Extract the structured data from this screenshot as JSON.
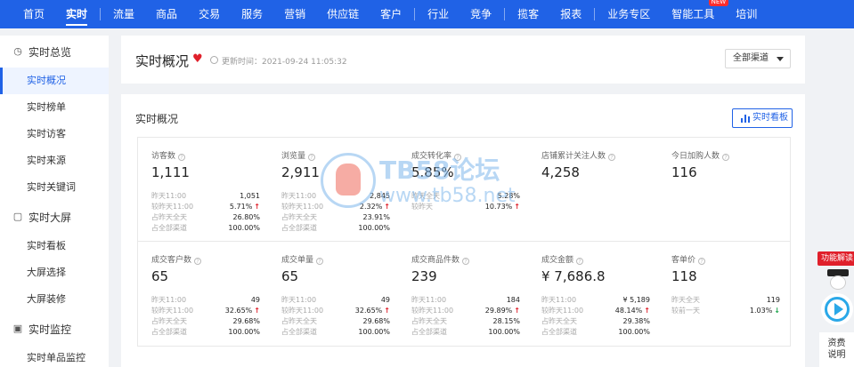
{
  "topnav": {
    "items": [
      {
        "label": "首页",
        "active": false
      },
      {
        "label": "实时",
        "active": true
      },
      {
        "label": "流量",
        "active": false
      },
      {
        "label": "商品",
        "active": false
      },
      {
        "label": "交易",
        "active": false
      },
      {
        "label": "服务",
        "active": false
      },
      {
        "label": "营销",
        "active": false
      },
      {
        "label": "供应链",
        "active": false
      },
      {
        "label": "客户",
        "active": false
      },
      {
        "label": "行业",
        "active": false
      },
      {
        "label": "竞争",
        "active": false
      },
      {
        "label": "揽客",
        "active": false
      },
      {
        "label": "报表",
        "active": false
      },
      {
        "label": "业务专区",
        "active": false
      },
      {
        "label": "智能工具",
        "active": false,
        "badge": "NEW"
      },
      {
        "label": "培训",
        "active": false
      }
    ]
  },
  "sidebar": {
    "groups": [
      {
        "title": "实时总览",
        "icon": "clock-icon",
        "items": [
          {
            "label": "实时概况",
            "active": true
          },
          {
            "label": "实时榜单",
            "active": false
          },
          {
            "label": "实时访客",
            "active": false
          },
          {
            "label": "实时来源",
            "active": false
          },
          {
            "label": "实时关键词",
            "active": false
          }
        ]
      },
      {
        "title": "实时大屏",
        "icon": "screen-icon",
        "items": [
          {
            "label": "实时看板",
            "active": false
          },
          {
            "label": "大屏选择",
            "active": false
          },
          {
            "label": "大屏装修",
            "active": false
          }
        ]
      },
      {
        "title": "实时监控",
        "icon": "monitor-icon",
        "items": [
          {
            "label": "实时单品监控",
            "active": false
          }
        ]
      }
    ]
  },
  "header": {
    "title": "实时概况",
    "update_time": "更新时间：2021-09-24 11:05:32",
    "channel": "全部渠道"
  },
  "overview": {
    "title": "实时概况",
    "board_button": "实时看板",
    "metrics": [
      {
        "label": "访客数",
        "value": "1,111",
        "stats": [
          {
            "label": "昨天11:00",
            "value": "1,051"
          },
          {
            "label": "较昨天11:00",
            "value": "5.71%",
            "trend": "up"
          },
          {
            "label": "占昨天全天",
            "value": "26.80%"
          },
          {
            "label": "占全部渠道",
            "value": "100.00%"
          }
        ]
      },
      {
        "label": "浏览量",
        "value": "2,911",
        "stats": [
          {
            "label": "昨天11:00",
            "value": "2,845"
          },
          {
            "label": "较昨天11:00",
            "value": "2.32%",
            "trend": "up"
          },
          {
            "label": "占昨天全天",
            "value": "23.91%"
          },
          {
            "label": "占全部渠道",
            "value": "100.00%"
          }
        ]
      },
      {
        "label": "成交转化率",
        "value": "5.85%",
        "stats": [
          {
            "label": "昨天全天",
            "value": "5.28%"
          },
          {
            "label": "较昨天",
            "value": "10.73%",
            "trend": "up"
          }
        ]
      },
      {
        "label": "店铺累计关注人数",
        "value": "4,258",
        "stats": []
      },
      {
        "label": "今日加购人数",
        "value": "116",
        "stats": []
      },
      {
        "label": "成交客户数",
        "value": "65",
        "stats": [
          {
            "label": "昨天11:00",
            "value": "49"
          },
          {
            "label": "较昨天11:00",
            "value": "32.65%",
            "trend": "up"
          },
          {
            "label": "占昨天全天",
            "value": "29.68%"
          },
          {
            "label": "占全部渠道",
            "value": "100.00%"
          }
        ]
      },
      {
        "label": "成交单量",
        "value": "65",
        "stats": [
          {
            "label": "昨天11:00",
            "value": "49"
          },
          {
            "label": "较昨天11:00",
            "value": "32.65%",
            "trend": "up"
          },
          {
            "label": "占昨天全天",
            "value": "29.68%"
          },
          {
            "label": "占全部渠道",
            "value": "100.00%"
          }
        ]
      },
      {
        "label": "成交商品件数",
        "value": "239",
        "stats": [
          {
            "label": "昨天11:00",
            "value": "184"
          },
          {
            "label": "较昨天11:00",
            "value": "29.89%",
            "trend": "up"
          },
          {
            "label": "占昨天全天",
            "value": "28.15%"
          },
          {
            "label": "占全部渠道",
            "value": "100.00%"
          }
        ]
      },
      {
        "label": "成交金额",
        "value": "¥ 7,686.8",
        "stats": [
          {
            "label": "昨天11:00",
            "value": "¥ 5,189"
          },
          {
            "label": "较昨天11:00",
            "value": "48.14%",
            "trend": "up"
          },
          {
            "label": "占昨天全天",
            "value": "29.38%"
          },
          {
            "label": "占全部渠道",
            "value": "100.00%"
          }
        ]
      },
      {
        "label": "客单价",
        "value": "118",
        "stats": [
          {
            "label": "昨天全天",
            "value": "119"
          },
          {
            "label": "较前一天",
            "value": "1.03%",
            "trend": "down"
          }
        ]
      }
    ]
  },
  "watermark": {
    "line1": "TB58论坛",
    "line2": "www.tb58.net"
  },
  "floating": {
    "feature_tag": "功能解读",
    "doc_label_1": "资费",
    "doc_label_2": "说明"
  },
  "colors": {
    "brand": "#2062e6",
    "up": "#e0202b",
    "down": "#1aa34a"
  }
}
